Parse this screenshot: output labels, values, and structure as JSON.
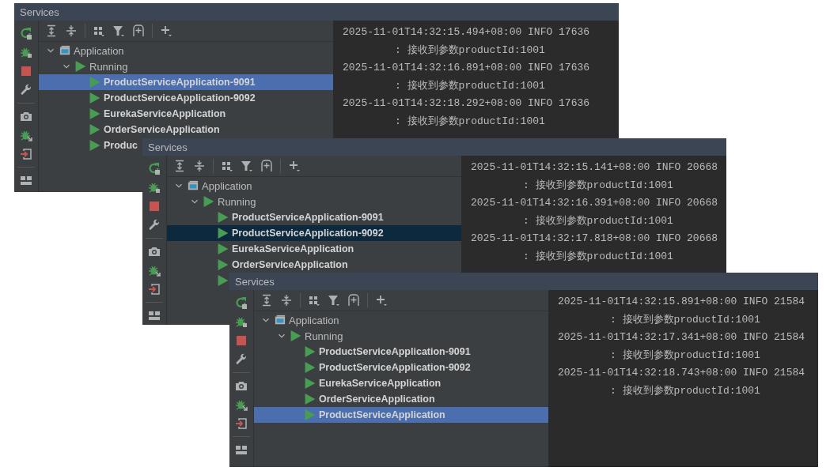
{
  "panels": [
    {
      "title": "Services",
      "focused": true,
      "tree": [
        {
          "label": "Application",
          "kind": "group",
          "expanded": true,
          "children": [
            {
              "label": "Running",
              "kind": "status",
              "expanded": true,
              "children": [
                {
                  "label": "ProductServiceApplication-9091",
                  "kind": "service",
                  "selected": true
                },
                {
                  "label": "ProductServiceApplication-9092",
                  "kind": "service",
                  "selected": false
                },
                {
                  "label": "EurekaServiceApplication",
                  "kind": "service",
                  "selected": false
                },
                {
                  "label": "OrderServiceApplication",
                  "kind": "service",
                  "selected": false
                },
                {
                  "label": "Produc",
                  "kind": "service",
                  "selected": false
                }
              ]
            }
          ]
        }
      ],
      "console": [
        {
          "header": "2025-11-01T14:32:15.494+08:00  INFO 17636",
          "message": ": 接收到参数productId:1001"
        },
        {
          "header": "2025-11-01T14:32:16.891+08:00  INFO 17636",
          "message": ": 接收到参数productId:1001"
        },
        {
          "header": "2025-11-01T14:32:18.292+08:00  INFO 17636",
          "message": ": 接收到参数productId:1001"
        }
      ]
    },
    {
      "title": "Services",
      "focused": false,
      "tree": [
        {
          "label": "Application",
          "kind": "group",
          "expanded": true,
          "children": [
            {
              "label": "Running",
              "kind": "status",
              "expanded": true,
              "children": [
                {
                  "label": "ProductServiceApplication-9091",
                  "kind": "service",
                  "selected": false
                },
                {
                  "label": "ProductServiceApplication-9092",
                  "kind": "service",
                  "selected": true
                },
                {
                  "label": "EurekaServiceApplication",
                  "kind": "service",
                  "selected": false
                },
                {
                  "label": "OrderServiceApplication",
                  "kind": "service",
                  "selected": false
                },
                {
                  "kind": "service",
                  "selected": false
                }
              ]
            }
          ]
        }
      ],
      "console": [
        {
          "header": "2025-11-01T14:32:15.141+08:00  INFO 20668",
          "message": ": 接收到参数productId:1001"
        },
        {
          "header": "2025-11-01T14:32:16.391+08:00  INFO 20668",
          "message": ": 接收到参数productId:1001"
        },
        {
          "header": "2025-11-01T14:32:17.818+08:00  INFO 20668",
          "message": ": 接收到参数productId:1001"
        }
      ]
    },
    {
      "title": "Services",
      "focused": true,
      "tree": [
        {
          "label": "Application",
          "kind": "group",
          "expanded": true,
          "children": [
            {
              "label": "Running",
              "kind": "status",
              "expanded": true,
              "children": [
                {
                  "label": "ProductServiceApplication-9091",
                  "kind": "service",
                  "selected": false
                },
                {
                  "label": "ProductServiceApplication-9092",
                  "kind": "service",
                  "selected": false
                },
                {
                  "label": "EurekaServiceApplication",
                  "kind": "service",
                  "selected": false
                },
                {
                  "label": "OrderServiceApplication",
                  "kind": "service",
                  "selected": false
                },
                {
                  "label": "ProductServiceApplication",
                  "kind": "service",
                  "selected": true
                }
              ]
            }
          ]
        }
      ],
      "console": [
        {
          "header": "2025-11-01T14:32:15.891+08:00  INFO 21584",
          "message": ": 接收到参数productId:1001"
        },
        {
          "header": "2025-11-01T14:32:17.341+08:00  INFO 21584",
          "message": ": 接收到参数productId:1001"
        },
        {
          "header": "2025-11-01T14:32:18.743+08:00  INFO 21584",
          "message": ": 接收到参数productId:1001"
        }
      ]
    }
  ]
}
